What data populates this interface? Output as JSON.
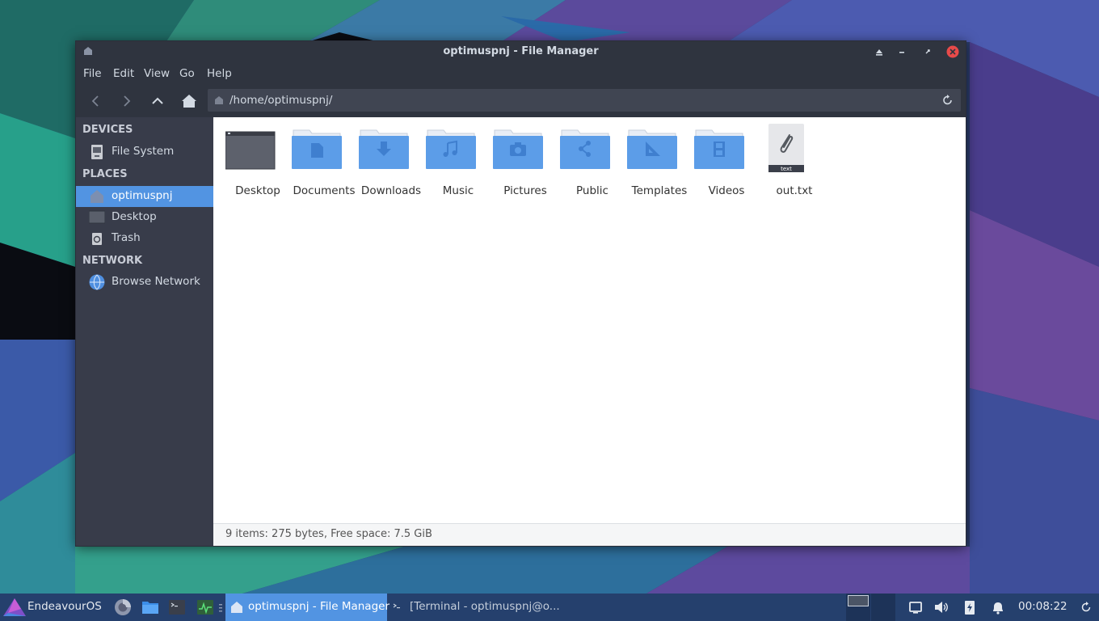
{
  "window": {
    "title": "optimuspnj - File Manager"
  },
  "menu": {
    "file": "File",
    "edit": "Edit",
    "view": "View",
    "go": "Go",
    "help": "Help"
  },
  "toolbar": {
    "location": "/home/optimuspnj/"
  },
  "sidebar": {
    "devices_header": "DEVICES",
    "places_header": "PLACES",
    "network_header": "NETWORK",
    "devices": [
      {
        "label": "File System",
        "icon": "drive-icon"
      }
    ],
    "places": [
      {
        "label": "optimuspnj",
        "icon": "home-folder-icon",
        "selected": true
      },
      {
        "label": "Desktop",
        "icon": "desktop-folder-icon"
      },
      {
        "label": "Trash",
        "icon": "trash-icon"
      }
    ],
    "network": [
      {
        "label": "Browse Network",
        "icon": "network-globe-icon"
      }
    ]
  },
  "files": [
    {
      "name": "Desktop",
      "icon": "desktop-folder-icon"
    },
    {
      "name": "Documents",
      "icon": "documents-folder-icon"
    },
    {
      "name": "Downloads",
      "icon": "downloads-folder-icon"
    },
    {
      "name": "Music",
      "icon": "music-folder-icon"
    },
    {
      "name": "Pictures",
      "icon": "pictures-folder-icon"
    },
    {
      "name": "Public",
      "icon": "public-folder-icon"
    },
    {
      "name": "Templates",
      "icon": "templates-folder-icon"
    },
    {
      "name": "Videos",
      "icon": "videos-folder-icon"
    },
    {
      "name": "out.txt",
      "icon": "text-file-icon",
      "badge": "text"
    }
  ],
  "status": {
    "text": "9 items: 275 bytes, Free space: 7.5 GiB"
  },
  "taskbar": {
    "menu_label": "EndeavourOS",
    "tasks": [
      {
        "label": "optimuspnj - File Manager",
        "active": true
      },
      {
        "label": "[Terminal - optimuspnj@o...",
        "active": false
      }
    ],
    "clock": "00:08:22"
  },
  "colors": {
    "accent": "#5294e2",
    "window_bg": "#383c4a",
    "titlebar_bg": "#2f343f",
    "folder_blue": "#5c9de8",
    "close_red": "#e84a4a",
    "taskbar_bg": "#25406d"
  }
}
